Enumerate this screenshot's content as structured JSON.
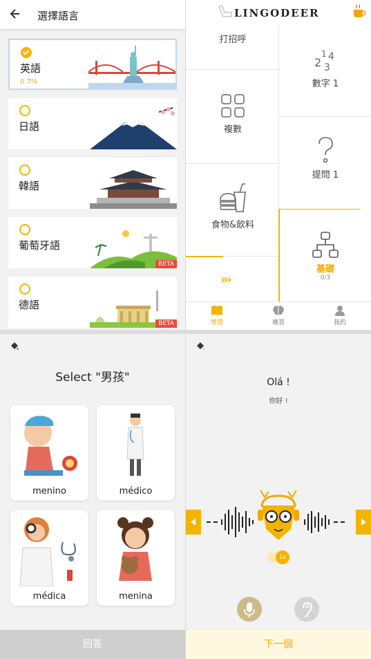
{
  "select_language": {
    "title": "選擇語言",
    "languages": [
      {
        "name": "英語",
        "progress": "0.7%",
        "selected": true
      },
      {
        "name": "日語",
        "progress": "",
        "selected": false
      },
      {
        "name": "韓語",
        "progress": "",
        "selected": false
      },
      {
        "name": "葡萄牙語",
        "progress": "",
        "selected": false,
        "badge": "BETA"
      },
      {
        "name": "德語",
        "progress": "",
        "selected": false,
        "badge": "BETA"
      }
    ]
  },
  "course_map": {
    "logo": "LINGODEER",
    "lessons": [
      {
        "label": "打招呼",
        "icon": "chair-icon"
      },
      {
        "label": "數字 1",
        "icon": "numbers-icon"
      },
      {
        "label": "複數",
        "icon": "grid-icon"
      },
      {
        "label": "提問 1",
        "icon": "question-icon"
      },
      {
        "label": "食物&飲料",
        "icon": "food-icon"
      },
      {
        "label": "基礎",
        "count": "0/3",
        "icon": "hierarchy-icon",
        "active": true
      }
    ],
    "nav": [
      {
        "label": "學習",
        "icon": "book-icon",
        "active": true
      },
      {
        "label": "複習",
        "icon": "brain-icon",
        "active": false
      },
      {
        "label": "我的",
        "icon": "person-icon",
        "active": false
      }
    ],
    "accent": "#f2b400"
  },
  "quiz": {
    "prompt": "Select \"男孩\"",
    "options": [
      "menino",
      "médico",
      "médica",
      "menina"
    ],
    "answer_label": "回答"
  },
  "speaking": {
    "phrase": "Olá !",
    "translation": "你好 !",
    "speed": "1x",
    "next_label": "下一個"
  }
}
